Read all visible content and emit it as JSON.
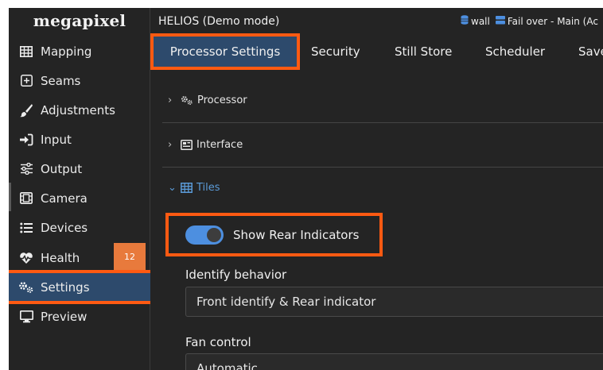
{
  "brand": {
    "logo": "megapixel"
  },
  "window": {
    "title": "HELIOS (Demo mode)"
  },
  "status": {
    "wall_label": "wall",
    "failover_label": "Fail over - Main (Ac",
    "icon_color": "#4d8fe0"
  },
  "sidebar": {
    "items": [
      {
        "label": "Mapping",
        "icon": "grid-icon"
      },
      {
        "label": "Seams",
        "icon": "plus-box-icon"
      },
      {
        "label": "Adjustments",
        "icon": "brush-icon"
      },
      {
        "label": "Input",
        "icon": "sign-in-icon"
      },
      {
        "label": "Output",
        "icon": "sliders-icon"
      },
      {
        "label": "Camera",
        "icon": "film-icon"
      },
      {
        "label": "Devices",
        "icon": "list-icon"
      },
      {
        "label": "Health",
        "icon": "heartbeat-icon",
        "badge": "12"
      },
      {
        "label": "Settings",
        "icon": "gears-icon",
        "active": true
      },
      {
        "label": "Preview",
        "icon": "monitor-icon"
      }
    ]
  },
  "tabs": [
    {
      "label": "Processor Settings",
      "active": true
    },
    {
      "label": "Security"
    },
    {
      "label": "Still Store"
    },
    {
      "label": "Scheduler"
    },
    {
      "label": "Save"
    }
  ],
  "sections": {
    "processor": {
      "label": "Processor",
      "expanded": false
    },
    "interface": {
      "label": "Interface",
      "expanded": false
    },
    "tiles": {
      "label": "Tiles",
      "expanded": true
    }
  },
  "tiles": {
    "show_rear_indicators": {
      "label": "Show Rear Indicators",
      "enabled": true
    },
    "identify_behavior": {
      "label": "Identify behavior",
      "value": "Front identify & Rear indicator"
    },
    "fan_control": {
      "label": "Fan control",
      "value": "Automatic"
    }
  },
  "colors": {
    "accent_blue": "#4d8fe0",
    "highlight_orange": "#ff5a12",
    "active_bg": "#2d4a6c",
    "badge_orange": "#e87a3c"
  }
}
